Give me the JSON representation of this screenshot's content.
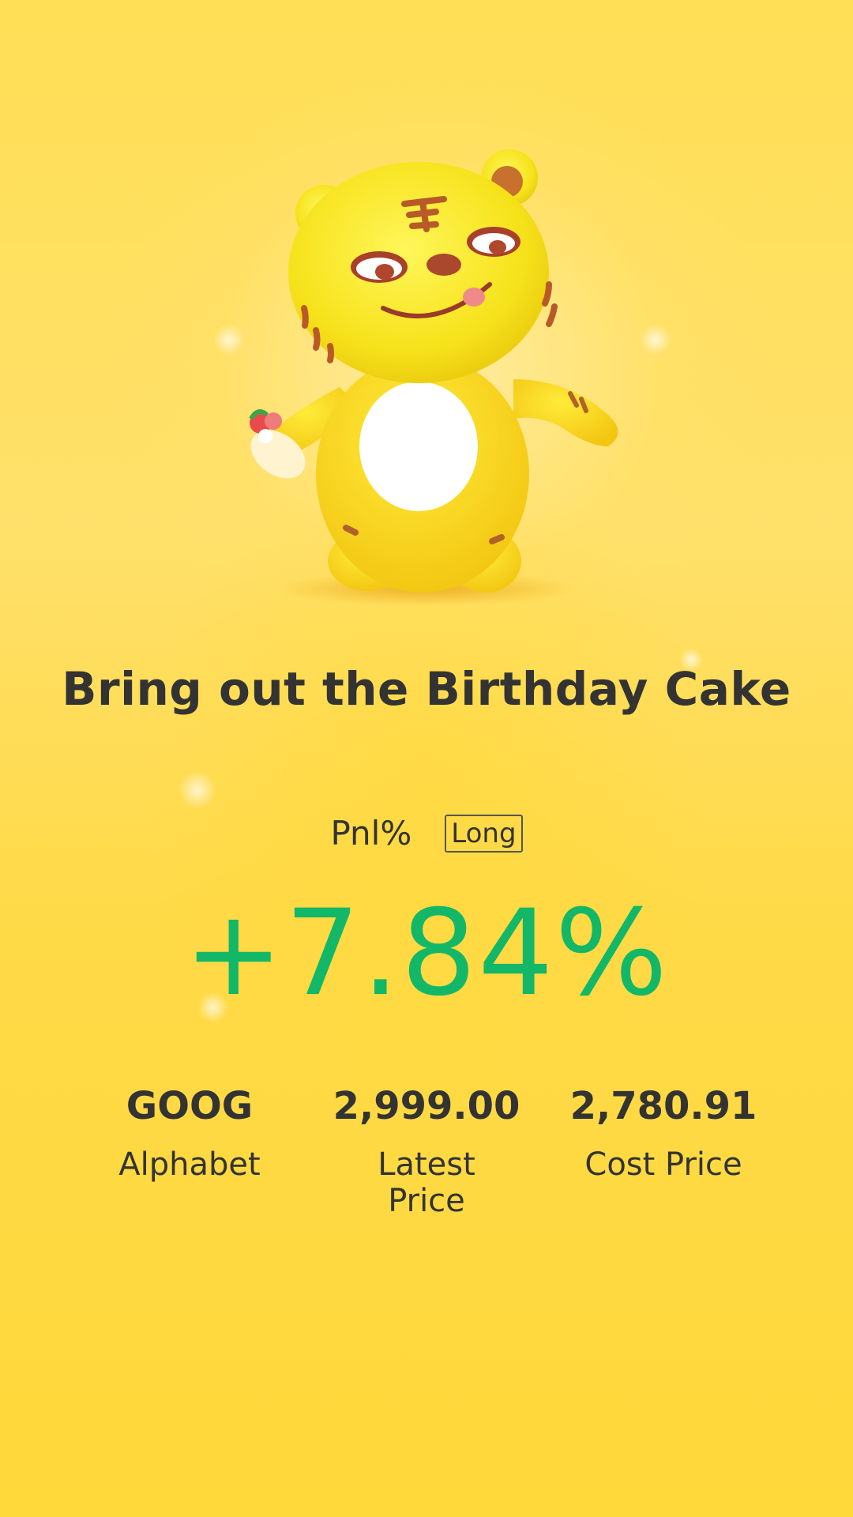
{
  "title": "Bring out the Birthday Cake",
  "pnl": {
    "label": "Pnl%",
    "badge": "Long",
    "value": "+7.84%"
  },
  "stats": [
    {
      "value": "GOOG",
      "label": "Alphabet"
    },
    {
      "value": "2,999.00",
      "label": "Latest Price"
    },
    {
      "value": "2,780.91",
      "label": "Cost Price"
    }
  ],
  "colors": {
    "background": "#FFDB4A",
    "text": "#333333",
    "positive": "#13B768"
  },
  "mascot_icon": "tiger-mascot-icon"
}
